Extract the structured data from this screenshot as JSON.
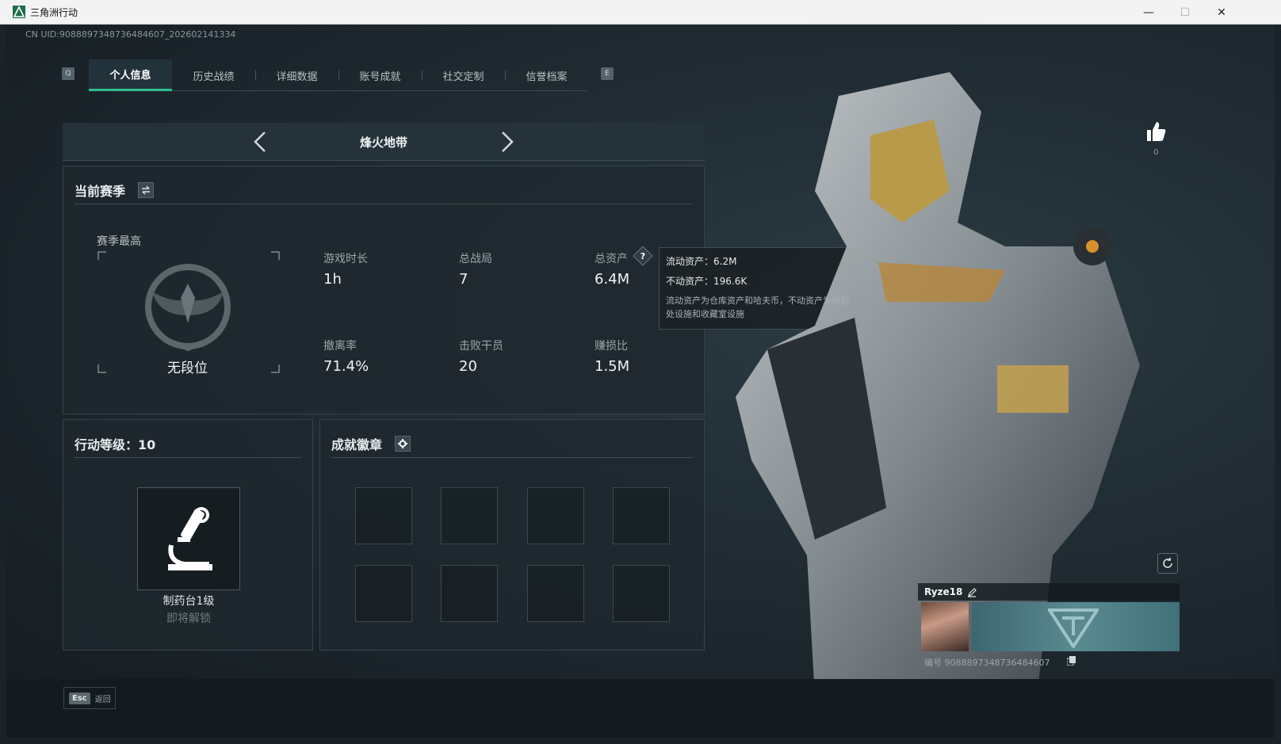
{
  "window": {
    "title": "三角洲行动",
    "minimize": "—",
    "maximize": "☐",
    "close": "✕"
  },
  "uid": "CN UID:9088897348736484607_202602141334",
  "tabs": [
    {
      "label": "个人信息",
      "active": true
    },
    {
      "label": "历史战绩",
      "active": false
    },
    {
      "label": "详细数据",
      "active": false
    },
    {
      "label": "账号成就",
      "active": false
    },
    {
      "label": "社交定制",
      "active": false
    },
    {
      "label": "信誉档案",
      "active": false
    }
  ],
  "tab_keys": {
    "left": "Q",
    "right": "E"
  },
  "mode": {
    "title": "烽火地带"
  },
  "season": {
    "title": "当前赛季",
    "best_label": "赛季最高",
    "rank": "无段位",
    "stats": [
      {
        "label": "游戏时长",
        "value": "1h"
      },
      {
        "label": "总战局",
        "value": "7"
      },
      {
        "label": "总资产",
        "value": "6.4M"
      },
      {
        "label": "撤离率",
        "value": "71.4%"
      },
      {
        "label": "击败干员",
        "value": "20"
      },
      {
        "label": "赚损比",
        "value": "1.5M"
      }
    ]
  },
  "tooltip": {
    "liquid": "流动资产：6.2M",
    "fixed": "不动资产：196.6K",
    "desc": "流动资产为仓库资产和哈夫币，不动资产为特勤处设施和收藏室设施"
  },
  "level": {
    "title": "行动等级：10",
    "item_name": "制药台1级",
    "item_status": "即将解锁"
  },
  "badges": {
    "title": "成就徽章"
  },
  "like": {
    "count": "0"
  },
  "card": {
    "name": "Ryze18",
    "id": "编号 9088897348736484607"
  },
  "esc": {
    "key": "Esc",
    "label": "返回"
  },
  "colors": {
    "accent": "#2fbf8f",
    "bg": "#1a2329",
    "panel": "#1e282e"
  }
}
